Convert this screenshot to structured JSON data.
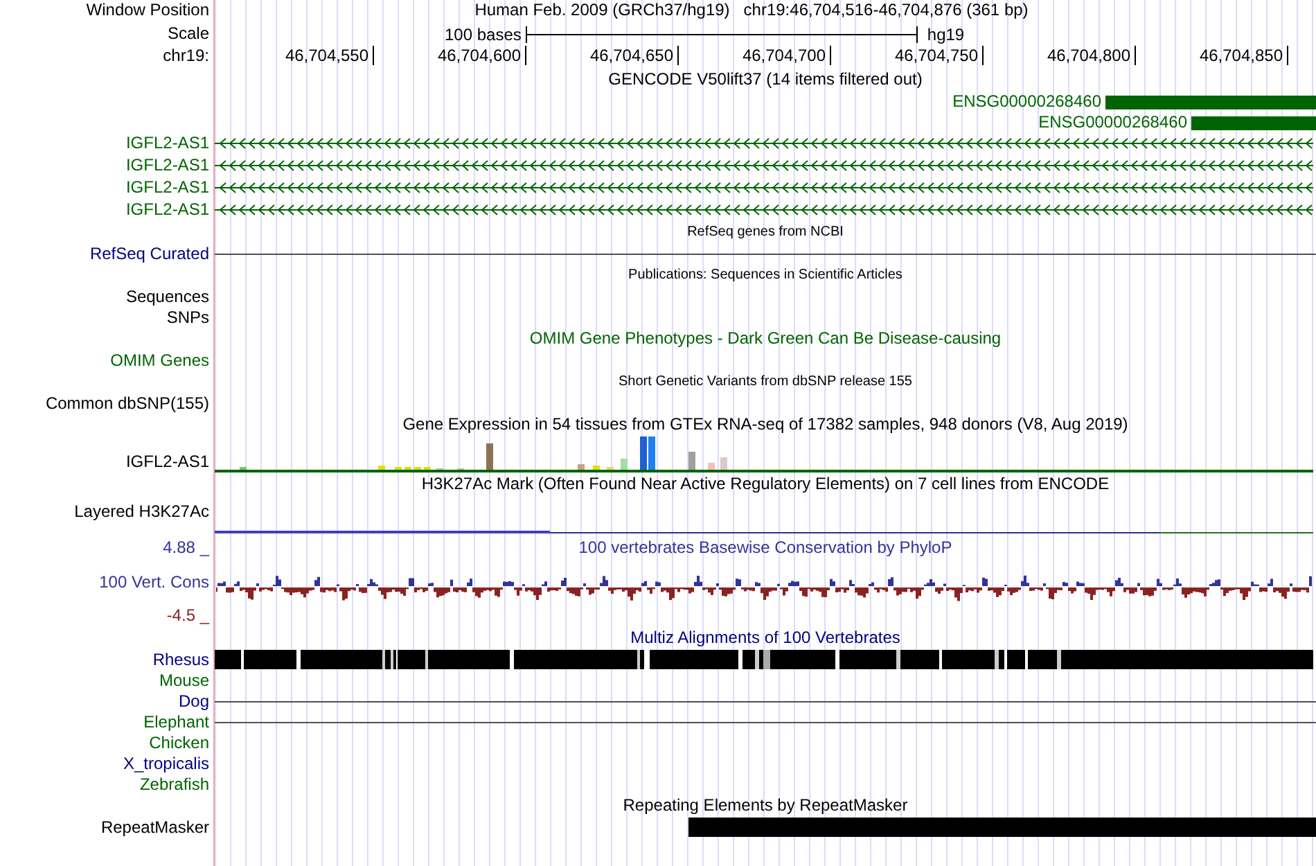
{
  "position": {
    "label": "Window Position",
    "text": "Human Feb. 2009 (GRCh37/hg19)   chr19:46,704,516-46,704,876 (361 bp)"
  },
  "scale": {
    "label": "Scale",
    "length": "100 bases",
    "assembly": "hg19"
  },
  "ruler": {
    "label": "chr19:",
    "ticks": [
      "46,704,550",
      "46,704,600",
      "46,704,650",
      "46,704,700",
      "46,704,750",
      "46,704,800",
      "46,704,850"
    ]
  },
  "tracks": [
    {
      "kind": "title",
      "text": "GENCODE V50lift37 (14 items filtered out)",
      "color": "#000000"
    },
    {
      "kind": "feature",
      "text": "ENSG00000268460",
      "color": "#006400"
    },
    {
      "kind": "feature",
      "text": "ENSG00000268460",
      "color": "#006400"
    },
    {
      "kind": "gene",
      "label": "IGFL2-AS1",
      "color": "#006400"
    },
    {
      "kind": "gene",
      "label": "IGFL2-AS1",
      "color": "#006400"
    },
    {
      "kind": "gene",
      "label": "IGFL2-AS1",
      "color": "#006400"
    },
    {
      "kind": "gene",
      "label": "IGFL2-AS1",
      "color": "#006400"
    },
    {
      "kind": "caption",
      "text": "RefSeq genes from NCBI"
    },
    {
      "kind": "line",
      "label": "RefSeq Curated",
      "color": "#000080"
    },
    {
      "kind": "caption",
      "text": "Publications: Sequences in Scientific Articles"
    },
    {
      "kind": "label",
      "label": "Sequences",
      "color": "#000000"
    },
    {
      "kind": "label",
      "label": "SNPs",
      "color": "#000000"
    },
    {
      "kind": "title",
      "text": "OMIM Gene Phenotypes - Dark Green Can Be Disease-causing",
      "color": "#006400"
    },
    {
      "kind": "label",
      "label": "OMIM Genes",
      "color": "#006400"
    },
    {
      "kind": "caption",
      "text": "Short Genetic Variants from dbSNP release 155"
    },
    {
      "kind": "label",
      "label": "Common dbSNP(155)",
      "color": "#000000"
    },
    {
      "kind": "title",
      "text": "Gene Expression in 54 tissues from GTEx RNA-seq of 17382 samples, 948 donors (V8, Aug 2019)",
      "color": "#000000"
    },
    {
      "kind": "bars",
      "label": "IGFL2-AS1",
      "color": "#000000"
    },
    {
      "kind": "title",
      "text": "H3K27Ac Mark (Often Found Near Active Regulatory Elements) on 7 cell lines from ENCODE",
      "color": "#000000"
    },
    {
      "kind": "layered",
      "label": "Layered H3K27Ac",
      "color": "#000000"
    },
    {
      "kind": "wiggle",
      "label": "100 Vert. Cons",
      "max": "4.88 _",
      "min": "-4.5 _",
      "title": "100 vertebrates Basewise Conservation by PhyloP",
      "color": "#333399"
    },
    {
      "kind": "title",
      "text": "Multiz Alignments of 100 Vertebrates",
      "color": "#000080"
    },
    {
      "kind": "alignment",
      "label": "Rhesus",
      "color": "#000080"
    },
    {
      "kind": "label",
      "label": "Mouse",
      "color": "#006400"
    },
    {
      "kind": "line",
      "label": "Dog",
      "color": "#000080"
    },
    {
      "kind": "line",
      "label": "Elephant",
      "color": "#006400"
    },
    {
      "kind": "label",
      "label": "Chicken",
      "color": "#006400"
    },
    {
      "kind": "label",
      "label": "X_tropicalis",
      "color": "#000080"
    },
    {
      "kind": "label",
      "label": "Zebrafish",
      "color": "#006400"
    },
    {
      "kind": "title",
      "text": "Repeating Elements by RepeatMasker",
      "color": "#000000"
    },
    {
      "kind": "repeat",
      "label": "RepeatMasker",
      "color": "#000000"
    }
  ]
}
